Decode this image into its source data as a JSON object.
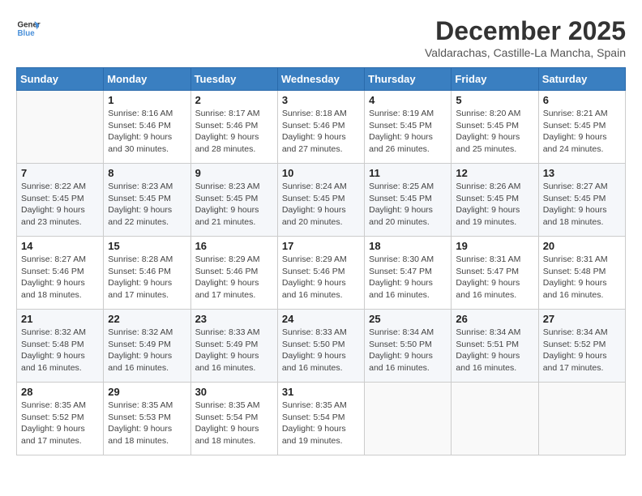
{
  "logo": {
    "line1": "General",
    "line2": "Blue"
  },
  "title": "December 2025",
  "subtitle": "Valdarachas, Castille-La Mancha, Spain",
  "days_header": [
    "Sunday",
    "Monday",
    "Tuesday",
    "Wednesday",
    "Thursday",
    "Friday",
    "Saturday"
  ],
  "weeks": [
    [
      {
        "day": "",
        "info": ""
      },
      {
        "day": "1",
        "info": "Sunrise: 8:16 AM\nSunset: 5:46 PM\nDaylight: 9 hours\nand 30 minutes."
      },
      {
        "day": "2",
        "info": "Sunrise: 8:17 AM\nSunset: 5:46 PM\nDaylight: 9 hours\nand 28 minutes."
      },
      {
        "day": "3",
        "info": "Sunrise: 8:18 AM\nSunset: 5:46 PM\nDaylight: 9 hours\nand 27 minutes."
      },
      {
        "day": "4",
        "info": "Sunrise: 8:19 AM\nSunset: 5:45 PM\nDaylight: 9 hours\nand 26 minutes."
      },
      {
        "day": "5",
        "info": "Sunrise: 8:20 AM\nSunset: 5:45 PM\nDaylight: 9 hours\nand 25 minutes."
      },
      {
        "day": "6",
        "info": "Sunrise: 8:21 AM\nSunset: 5:45 PM\nDaylight: 9 hours\nand 24 minutes."
      }
    ],
    [
      {
        "day": "7",
        "info": "Sunrise: 8:22 AM\nSunset: 5:45 PM\nDaylight: 9 hours\nand 23 minutes."
      },
      {
        "day": "8",
        "info": "Sunrise: 8:23 AM\nSunset: 5:45 PM\nDaylight: 9 hours\nand 22 minutes."
      },
      {
        "day": "9",
        "info": "Sunrise: 8:23 AM\nSunset: 5:45 PM\nDaylight: 9 hours\nand 21 minutes."
      },
      {
        "day": "10",
        "info": "Sunrise: 8:24 AM\nSunset: 5:45 PM\nDaylight: 9 hours\nand 20 minutes."
      },
      {
        "day": "11",
        "info": "Sunrise: 8:25 AM\nSunset: 5:45 PM\nDaylight: 9 hours\nand 20 minutes."
      },
      {
        "day": "12",
        "info": "Sunrise: 8:26 AM\nSunset: 5:45 PM\nDaylight: 9 hours\nand 19 minutes."
      },
      {
        "day": "13",
        "info": "Sunrise: 8:27 AM\nSunset: 5:45 PM\nDaylight: 9 hours\nand 18 minutes."
      }
    ],
    [
      {
        "day": "14",
        "info": "Sunrise: 8:27 AM\nSunset: 5:46 PM\nDaylight: 9 hours\nand 18 minutes."
      },
      {
        "day": "15",
        "info": "Sunrise: 8:28 AM\nSunset: 5:46 PM\nDaylight: 9 hours\nand 17 minutes."
      },
      {
        "day": "16",
        "info": "Sunrise: 8:29 AM\nSunset: 5:46 PM\nDaylight: 9 hours\nand 17 minutes."
      },
      {
        "day": "17",
        "info": "Sunrise: 8:29 AM\nSunset: 5:46 PM\nDaylight: 9 hours\nand 16 minutes."
      },
      {
        "day": "18",
        "info": "Sunrise: 8:30 AM\nSunset: 5:47 PM\nDaylight: 9 hours\nand 16 minutes."
      },
      {
        "day": "19",
        "info": "Sunrise: 8:31 AM\nSunset: 5:47 PM\nDaylight: 9 hours\nand 16 minutes."
      },
      {
        "day": "20",
        "info": "Sunrise: 8:31 AM\nSunset: 5:48 PM\nDaylight: 9 hours\nand 16 minutes."
      }
    ],
    [
      {
        "day": "21",
        "info": "Sunrise: 8:32 AM\nSunset: 5:48 PM\nDaylight: 9 hours\nand 16 minutes."
      },
      {
        "day": "22",
        "info": "Sunrise: 8:32 AM\nSunset: 5:49 PM\nDaylight: 9 hours\nand 16 minutes."
      },
      {
        "day": "23",
        "info": "Sunrise: 8:33 AM\nSunset: 5:49 PM\nDaylight: 9 hours\nand 16 minutes."
      },
      {
        "day": "24",
        "info": "Sunrise: 8:33 AM\nSunset: 5:50 PM\nDaylight: 9 hours\nand 16 minutes."
      },
      {
        "day": "25",
        "info": "Sunrise: 8:34 AM\nSunset: 5:50 PM\nDaylight: 9 hours\nand 16 minutes."
      },
      {
        "day": "26",
        "info": "Sunrise: 8:34 AM\nSunset: 5:51 PM\nDaylight: 9 hours\nand 16 minutes."
      },
      {
        "day": "27",
        "info": "Sunrise: 8:34 AM\nSunset: 5:52 PM\nDaylight: 9 hours\nand 17 minutes."
      }
    ],
    [
      {
        "day": "28",
        "info": "Sunrise: 8:35 AM\nSunset: 5:52 PM\nDaylight: 9 hours\nand 17 minutes."
      },
      {
        "day": "29",
        "info": "Sunrise: 8:35 AM\nSunset: 5:53 PM\nDaylight: 9 hours\nand 18 minutes."
      },
      {
        "day": "30",
        "info": "Sunrise: 8:35 AM\nSunset: 5:54 PM\nDaylight: 9 hours\nand 18 minutes."
      },
      {
        "day": "31",
        "info": "Sunrise: 8:35 AM\nSunset: 5:54 PM\nDaylight: 9 hours\nand 19 minutes."
      },
      {
        "day": "",
        "info": ""
      },
      {
        "day": "",
        "info": ""
      },
      {
        "day": "",
        "info": ""
      }
    ]
  ]
}
